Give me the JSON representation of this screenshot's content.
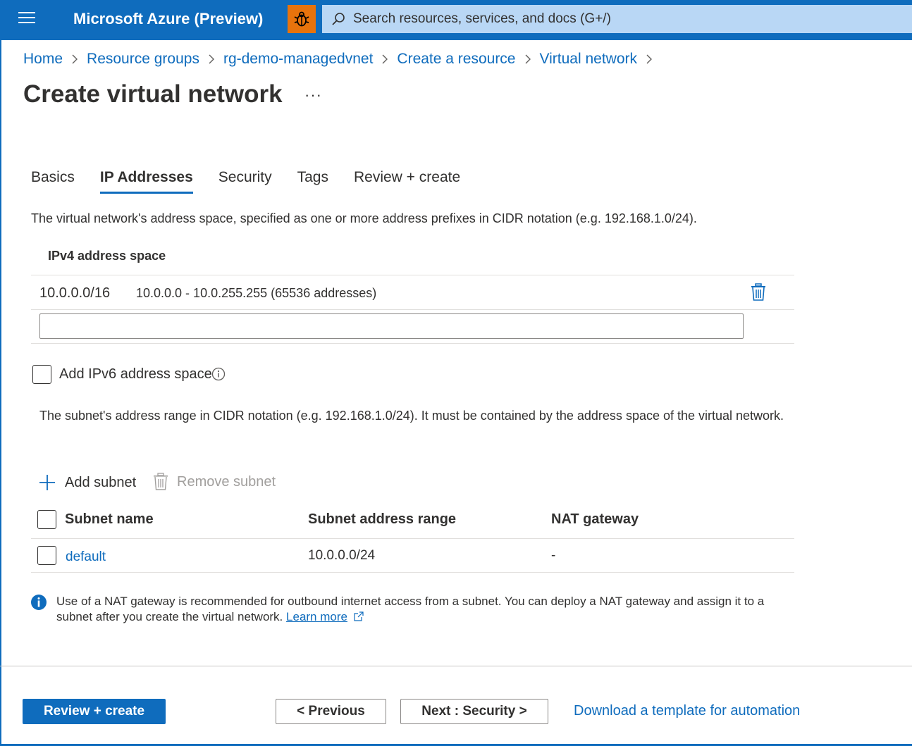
{
  "header": {
    "brand": "Microsoft Azure (Preview)",
    "search_placeholder": "Search resources, services, and docs (G+/)",
    "colors": {
      "bar": "#0f6cbd",
      "bug_button": "#e8730c",
      "search_bg": "#b9d7f5"
    }
  },
  "breadcrumb": [
    "Home",
    "Resource groups",
    "rg-demo-managedvnet",
    "Create a resource",
    "Virtual network"
  ],
  "page": {
    "title": "Create virtual network",
    "more": "···"
  },
  "tabs": [
    {
      "label": "Basics",
      "active": false
    },
    {
      "label": "IP Addresses",
      "active": true
    },
    {
      "label": "Security",
      "active": false
    },
    {
      "label": "Tags",
      "active": false
    },
    {
      "label": "Review + create",
      "active": false
    }
  ],
  "ip": {
    "description": "The virtual network's address space, specified as one or more address prefixes in CIDR notation (e.g. 192.168.1.0/24).",
    "ipv4_header": "IPv4 address space",
    "rows": [
      {
        "cidr": "10.0.0.0/16",
        "range": "10.0.0.0 - 10.0.255.255 (65536 addresses)"
      }
    ],
    "new_value": "",
    "ipv6_label": "Add IPv6 address space",
    "ipv6_checked": false
  },
  "subnets": {
    "description": "The subnet's address range in CIDR notation (e.g. 192.168.1.0/24). It must be contained by the address space of the virtual network.",
    "add_label": "Add subnet",
    "remove_label": "Remove subnet",
    "columns": [
      "Subnet name",
      "Subnet address range",
      "NAT gateway"
    ],
    "rows": [
      {
        "name": "default",
        "range": "10.0.0.0/24",
        "nat": "-"
      }
    ]
  },
  "info": {
    "text": "Use of a NAT gateway is recommended for outbound internet access from a subnet. You can deploy a NAT gateway and assign it to a subnet after you create the virtual network.",
    "link": "Learn more"
  },
  "footer": {
    "review_create": "Review + create",
    "previous": "< Previous",
    "next": "Next : Security >",
    "download": "Download a template for automation"
  }
}
